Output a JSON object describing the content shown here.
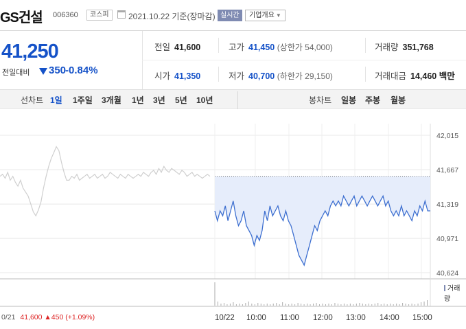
{
  "header": {
    "company": "GS건설",
    "code": "006360",
    "market": "코스피",
    "date_text": "2021.10.22 기준(장마감)",
    "realtime_label": "실시간",
    "info_label": "기업개요"
  },
  "price": {
    "current": "41,250",
    "change_label": "전일대비",
    "change": "350",
    "change_pct": "-0.84%"
  },
  "stats": {
    "prev_label": "전일",
    "prev": "41,600",
    "high_label": "고가",
    "high": "41,450",
    "upper_limit": "(상한가 54,000)",
    "volume_label": "거래량",
    "volume": "351,768",
    "open_label": "시가",
    "open": "41,350",
    "low_label": "저가",
    "low": "40,700",
    "lower_limit": "(하한가 29,150)",
    "value_label": "거래대금",
    "value": "14,460 백만"
  },
  "tabs": {
    "line_label": "선차트",
    "line_tabs": [
      "1일",
      "1주일",
      "3개월",
      "1년",
      "3년",
      "5년",
      "10년"
    ],
    "active_index": 0,
    "candle_label": "봉차트",
    "candle_tabs": [
      "일봉",
      "주봉",
      "월봉"
    ]
  },
  "footer": {
    "prefix": "0/21",
    "close": "41,600",
    "change": "▲450 (+1.09%)"
  },
  "volume_label": "거래량",
  "colors": {
    "blue": "#1552c8",
    "red": "#dd2222",
    "series_today": "#3d6fd0",
    "series_prev": "#cfcfcf",
    "fill_today": "#e6edfb"
  },
  "chart_data": {
    "type": "line",
    "y_ticks": [
      "42,015",
      "41,667",
      "41,319",
      "40,971",
      "40,624"
    ],
    "x_labels": [
      "10/22",
      "10:00",
      "11:00",
      "12:00",
      "13:00",
      "14:00",
      "15:00"
    ],
    "ylim": [
      40624,
      42015
    ],
    "series": [
      {
        "values": [
          41600,
          41620,
          41580,
          41640,
          41560,
          41600,
          41540,
          41500,
          41560,
          41480,
          41440,
          41400,
          41320,
          41240,
          41200,
          41260,
          41340,
          41480,
          41600,
          41700,
          41780,
          41840,
          41900,
          41860,
          41740,
          41640,
          41560,
          41560,
          41600,
          41580,
          41620,
          41560,
          41580,
          41600,
          41620,
          41580,
          41600,
          41620,
          41580,
          41600,
          41620,
          41580,
          41600,
          41640,
          41620,
          41600,
          41580,
          41620,
          41600,
          41580,
          41620,
          41600,
          41580,
          41600,
          41620,
          41600,
          41640,
          41620,
          41600,
          41640,
          41660,
          41620,
          41680,
          41640,
          41700,
          41660,
          41640,
          41680,
          41660,
          41640,
          41620,
          41660,
          41640,
          41600,
          41620,
          41640,
          41600,
          41620,
          41600,
          41580,
          41600,
          41620,
          41600
        ]
      },
      {
        "values": [
          41250,
          41150,
          41250,
          41200,
          41300,
          41150,
          41250,
          41350,
          41200,
          41100,
          41150,
          41250,
          41100,
          41050,
          41000,
          40900,
          41000,
          40950,
          41050,
          41250,
          41150,
          41300,
          41200,
          41250,
          41300,
          41200,
          41150,
          41250,
          41150,
          41100,
          41000,
          40900,
          40800,
          40750,
          40700,
          40800,
          40900,
          41000,
          41100,
          41050,
          41150,
          41200,
          41250,
          41200,
          41300,
          41350,
          41300,
          41350,
          41300,
          41400,
          41350,
          41300,
          41350,
          41400,
          41300,
          41350,
          41400,
          41350,
          41300,
          41350,
          41400,
          41350,
          41300,
          41350,
          41400,
          41300,
          41350,
          41250,
          41200,
          41250,
          41200,
          41300,
          41200,
          41250,
          41200,
          41150,
          41250,
          41200,
          41300,
          41250,
          41350,
          41250,
          41250
        ]
      }
    ],
    "reference_value": 41600
  }
}
